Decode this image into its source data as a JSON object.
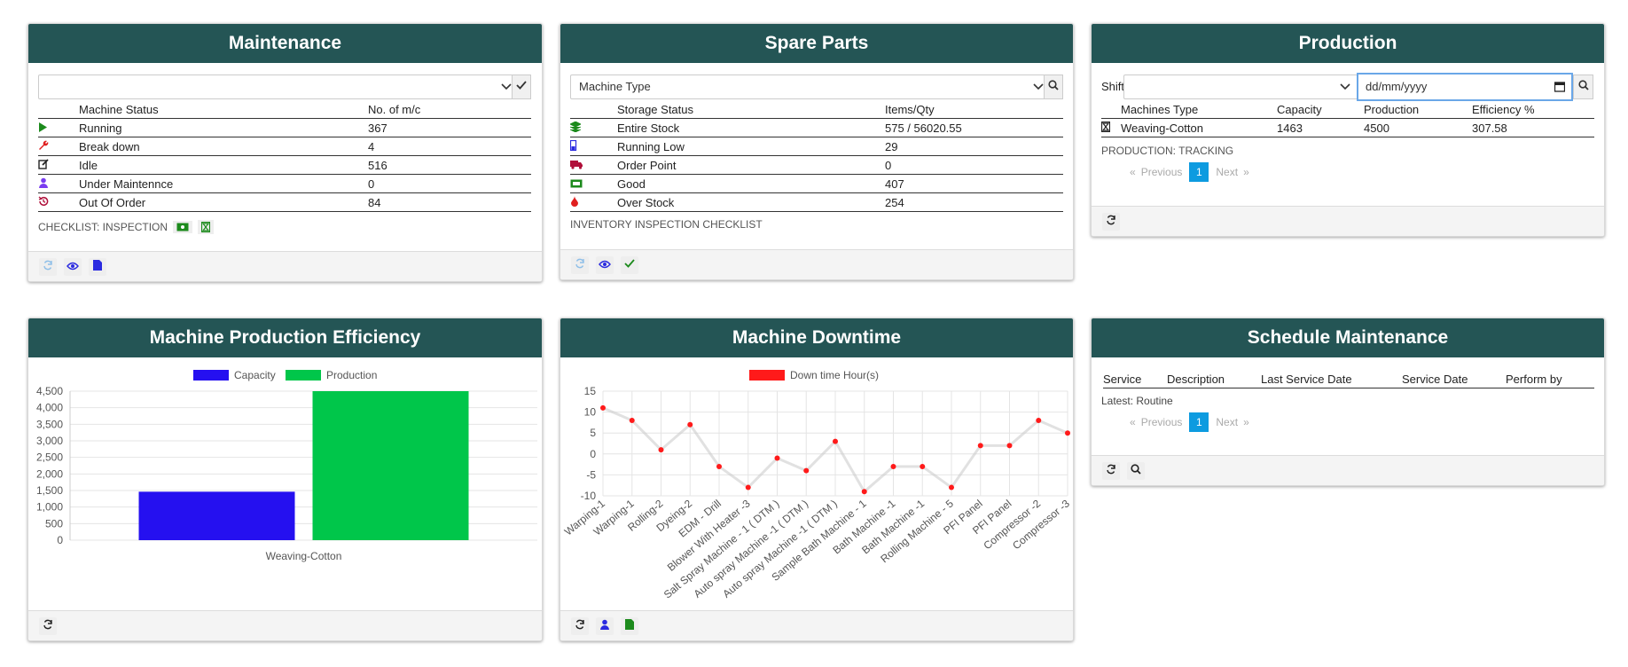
{
  "maintenance": {
    "title": "Maintenance",
    "select_value": "",
    "headers": [
      "Machine Status",
      "No. of m/c"
    ],
    "rows": [
      {
        "icon": "play-icon",
        "label": "Running",
        "value": "367"
      },
      {
        "icon": "wrench-icon",
        "label": "Break down",
        "value": "4"
      },
      {
        "icon": "edit-icon",
        "label": "Idle",
        "value": "516"
      },
      {
        "icon": "user-icon",
        "label": "Under Maintennce",
        "value": "0"
      },
      {
        "icon": "history-icon",
        "label": "Out Of Order",
        "value": "84"
      }
    ],
    "checklist_label": "CHECKLIST: INSPECTION"
  },
  "spare_parts": {
    "title": "Spare Parts",
    "select_value": "Machine Type",
    "headers": [
      "Storage Status",
      "Items/Qty"
    ],
    "rows": [
      {
        "icon": "layers-icon",
        "label": "Entire Stock",
        "value": "575 / 56020.55"
      },
      {
        "icon": "battery-low-icon",
        "label": "Running Low",
        "value": "29"
      },
      {
        "icon": "truck-icon",
        "label": "Order Point",
        "value": "0"
      },
      {
        "icon": "money-icon",
        "label": "Good",
        "value": "407"
      },
      {
        "icon": "drop-icon",
        "label": "Over Stock",
        "value": "254"
      }
    ],
    "checklist_label": "INVENTORY INSPECTION CHECKLIST"
  },
  "production": {
    "title": "Production",
    "shift_label": "Shift",
    "date_placeholder": "dd/mm/yyyy",
    "headers": [
      "Machines Type",
      "Capacity",
      "Production",
      "Efficiency %"
    ],
    "rows": [
      {
        "icon": "hourglass-icon",
        "type": "Weaving-Cotton",
        "capacity": "1463",
        "production": "4500",
        "efficiency": "307.58"
      }
    ],
    "tracking_label": "PRODUCTION: TRACKING",
    "pager": {
      "first": "«",
      "previous": "Previous",
      "page": "1",
      "next": "Next",
      "last": "»"
    }
  },
  "efficiency_chart": {
    "title": "Machine Production Efficiency",
    "legend": [
      "Capacity",
      "Production"
    ],
    "colors": {
      "capacity": "#2510f0",
      "production": "#00c64a"
    },
    "y_ticks": [
      "4,500",
      "4,000",
      "3,500",
      "3,000",
      "2,500",
      "2,000",
      "1,500",
      "1,000",
      "500",
      "0"
    ]
  },
  "downtime_chart": {
    "title": "Machine Downtime",
    "legend": "Down time Hour(s)",
    "color": "#ff1a1a",
    "y_ticks": [
      "15",
      "10",
      "5",
      "0",
      "-5",
      "-10"
    ]
  },
  "schedule": {
    "title": "Schedule Maintenance",
    "headers": [
      "Service",
      "Description",
      "Last Service Date",
      "Service Date",
      "Perform by"
    ],
    "latest_label": "Latest: Routine",
    "pager": {
      "first": "«",
      "previous": "Previous",
      "page": "1",
      "next": "Next",
      "last": "»"
    }
  },
  "chart_data": [
    {
      "type": "bar",
      "categories": [
        "Weaving-Cotton"
      ],
      "series": [
        {
          "name": "Capacity",
          "values": [
            1463
          ]
        },
        {
          "name": "Production",
          "values": [
            4500
          ]
        }
      ],
      "ylim": [
        0,
        4500
      ],
      "legend": "top-center",
      "grid": true
    },
    {
      "type": "line",
      "categories": [
        "Warping-1",
        "Warping-1",
        "Rolling-2",
        "Dyeing-2",
        "EDM - Drill",
        "Blower With Heater -3",
        "Salt Spray Machine - 1 ( DTM )",
        "Auto spray Machine -1 ( DTM )",
        "Auto spray Machine -1 ( DTM )",
        "Sample Bath Machine - 1",
        "Bath Machine -1",
        "Bath Machine -1",
        "Rolling Machine - 5",
        "PFI Panel",
        "PFI Panel",
        "Compressor -2",
        "Compressor -3"
      ],
      "series": [
        {
          "name": "Down time Hour(s)",
          "values": [
            11,
            8,
            1,
            7,
            -3,
            -8,
            -1,
            -4,
            3,
            -9,
            -3,
            -3,
            -8,
            2,
            2,
            8,
            5
          ]
        }
      ],
      "ylim": [
        -10,
        15
      ],
      "legend": "top-center",
      "grid": true
    }
  ]
}
